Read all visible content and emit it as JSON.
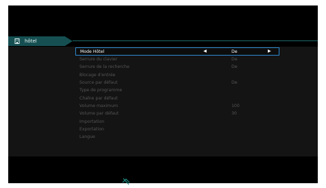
{
  "tab": {
    "label": "hôtel",
    "icon": "hotel-icon"
  },
  "menu": {
    "rows": [
      {
        "label": "Mode Hôtel",
        "value": "De",
        "selected": true
      },
      {
        "label": "Serrure du clavier",
        "value": "De"
      },
      {
        "label": "Serrure de la recherche",
        "value": "De"
      },
      {
        "label": "Blocage d'entrée",
        "value": ""
      },
      {
        "label": "Source par défaut",
        "value": "De"
      },
      {
        "label": "Type de programme",
        "value": ""
      },
      {
        "label": "Chaîne par défaut",
        "value": ""
      },
      {
        "label": "Volume maximum",
        "value": "100"
      },
      {
        "label": "Volume par défaut",
        "value": "30"
      },
      {
        "label": "Importation",
        "value": ""
      },
      {
        "label": "Exportation",
        "value": ""
      },
      {
        "label": "Langue",
        "value": ""
      }
    ]
  },
  "arrows": {
    "left": "◀",
    "right": "▶"
  },
  "status": {
    "icon": "network-disconnected-icon"
  },
  "colors": {
    "accent": "#2d8ad0",
    "tab": "#154f52",
    "panel": "#141414"
  }
}
